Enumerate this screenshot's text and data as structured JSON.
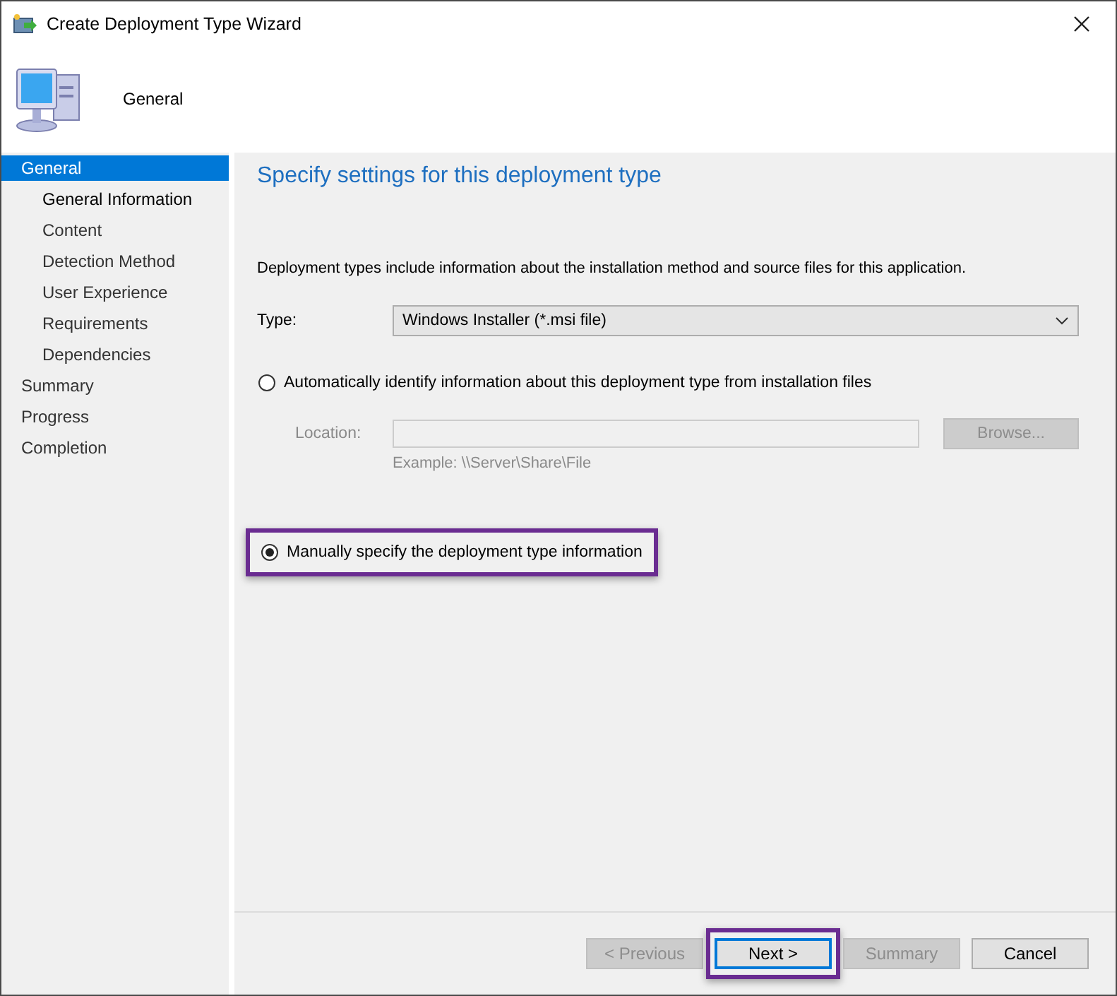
{
  "window": {
    "title": "Create Deployment Type Wizard"
  },
  "header": {
    "title": "General"
  },
  "sidebar": {
    "items": [
      {
        "label": "General",
        "selected": true,
        "children": [
          {
            "label": "General Information",
            "selected": false,
            "current": true
          },
          {
            "label": "Content",
            "selected": false,
            "current": false
          },
          {
            "label": "Detection Method",
            "selected": false,
            "current": false
          },
          {
            "label": "User Experience",
            "selected": false,
            "current": false
          },
          {
            "label": "Requirements",
            "selected": false,
            "current": false
          },
          {
            "label": "Dependencies",
            "selected": false,
            "current": false
          }
        ]
      },
      {
        "label": "Summary",
        "selected": false
      },
      {
        "label": "Progress",
        "selected": false
      },
      {
        "label": "Completion",
        "selected": false
      }
    ]
  },
  "page": {
    "heading": "Specify settings for this deployment type",
    "description": "Deployment types include information about the installation method and source files for this application.",
    "type": {
      "label": "Type:",
      "value": "Windows Installer (*.msi file)"
    },
    "auto_option": {
      "label": "Automatically identify information about this deployment type from installation files",
      "selected": false,
      "highlighted": false
    },
    "location": {
      "label": "Location:",
      "disabled": true,
      "example": "Example: \\\\Server\\Share\\File",
      "browse": "Browse..."
    },
    "manual_option": {
      "label": "Manually specify the deployment type information",
      "selected": true,
      "highlighted": true
    }
  },
  "buttons": [
    {
      "label": "< Previous",
      "disabled": true,
      "focused": false,
      "highlighted": false
    },
    {
      "label": "Next >",
      "disabled": false,
      "focused": true,
      "highlighted": true
    },
    {
      "label": "Summary",
      "disabled": true,
      "focused": false,
      "highlighted": false
    },
    {
      "label": "Cancel",
      "disabled": false,
      "focused": false,
      "highlighted": false
    }
  ]
}
